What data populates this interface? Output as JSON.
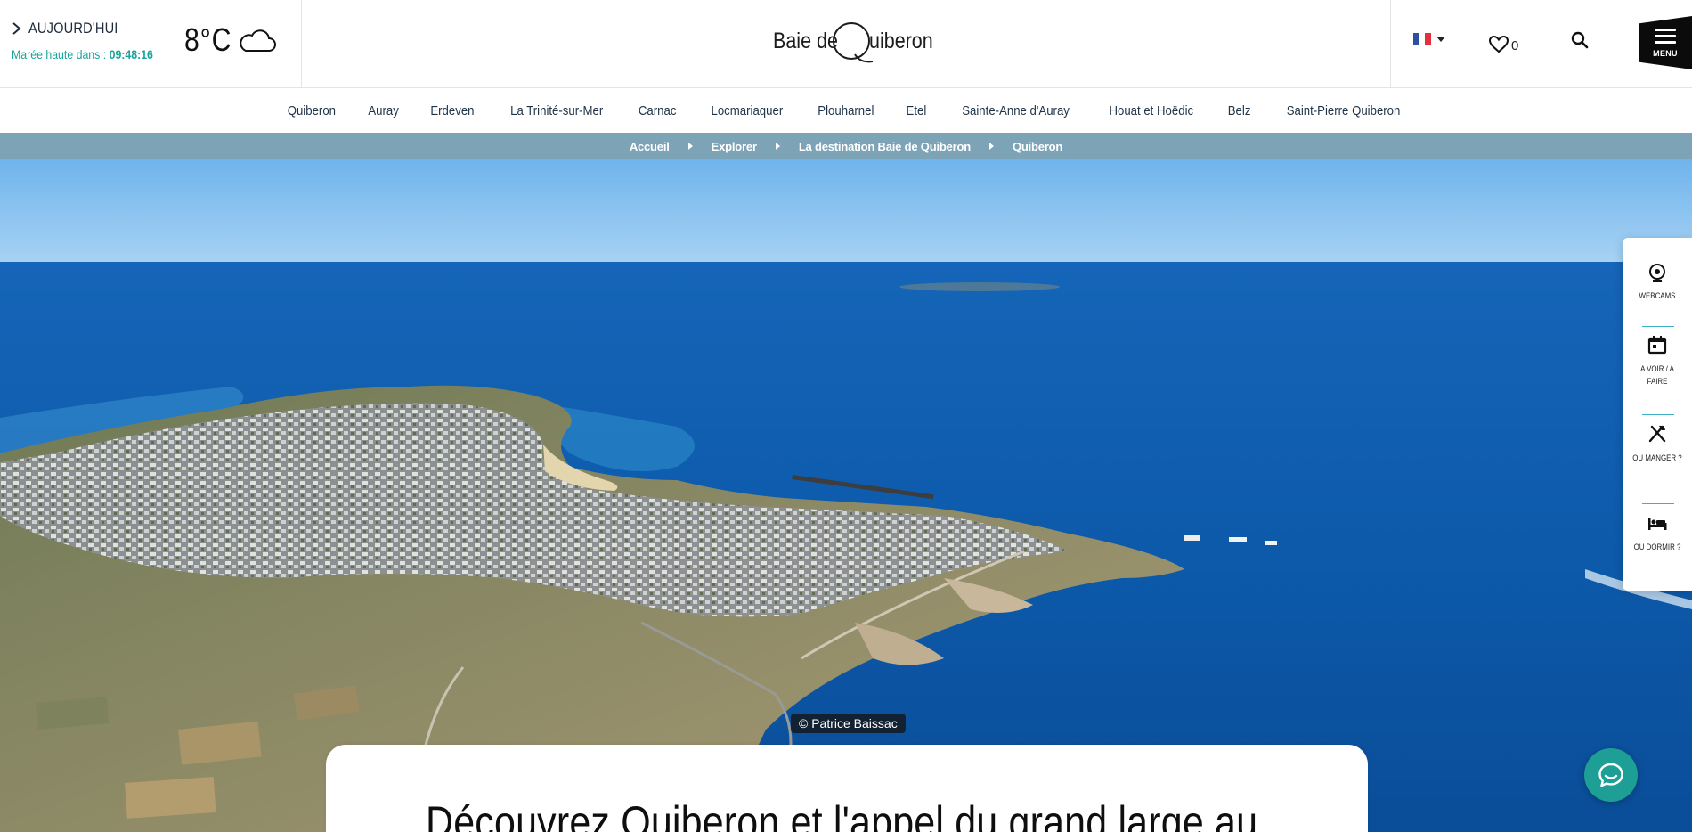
{
  "header": {
    "today_label": "AUJOURD'HUI",
    "tide_label": "Marée haute dans : ",
    "tide_time": "09:48:16",
    "temperature": "8°C",
    "weather_icon": "cloud-icon",
    "logo_text_a": "Baie de",
    "logo_text_b": "uiberon",
    "language": "FR",
    "favorites_count": "0",
    "menu_label": "MENU"
  },
  "towns": [
    "Quiberon",
    "Auray",
    "Erdeven",
    "La Trinité-sur-Mer",
    "Carnac",
    "Locmariaquer",
    "Plouharnel",
    "Etel",
    "Sainte-Anne d'Auray",
    "Houat et Hoëdic",
    "Belz",
    "Saint-Pierre Quiberon"
  ],
  "breadcrumb": {
    "items": [
      "Accueil",
      "Explorer",
      "La destination Baie de Quiberon"
    ],
    "current": "Quiberon"
  },
  "hero": {
    "credit": "© Patrice Baissac"
  },
  "quick_links": [
    {
      "label": "WEBCAMS",
      "icon": "webcam-icon"
    },
    {
      "label": "A VOIR / A FAIRE",
      "icon": "calendar-icon"
    },
    {
      "label": "OU MANGER ?",
      "icon": "cutlery-icon"
    },
    {
      "label": "OU DORMIR ?",
      "icon": "bed-icon"
    }
  ],
  "intro": {
    "title": "Découvrez Quiberon et l'appel du grand large au"
  },
  "colors": {
    "accent_teal": "#1aa39a",
    "breadcrumb_bg": "#7ca3b6",
    "chat_bg": "#1d9f95",
    "flag_blue": "#2b4fa3",
    "flag_red": "#e0313c"
  }
}
